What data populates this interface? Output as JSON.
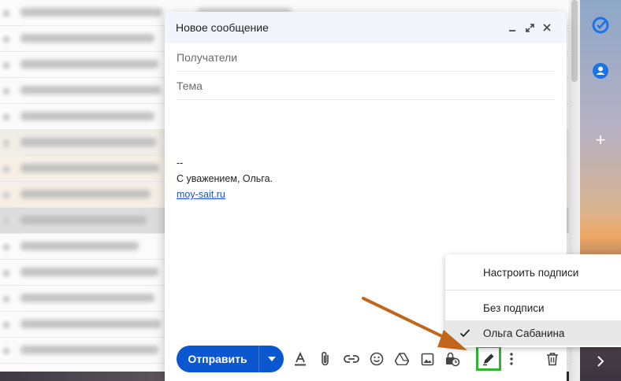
{
  "compose": {
    "title": "Новое сообщение",
    "recipients_placeholder": "Получатели",
    "subject_placeholder": "Тема",
    "signature": {
      "dashes": "--",
      "line": "С уважением, Ольга.",
      "link": "moy-sait.ru"
    },
    "send_label": "Отправить"
  },
  "signature_menu": {
    "manage": "Настроить подписи",
    "none": "Без подписи",
    "selected": "Ольга Сабанина"
  },
  "colors": {
    "primary": "#0b57d0",
    "highlight": "#2fb52f",
    "arrow": "#c0651a"
  },
  "icons": [
    "minimize-icon",
    "expand-icon",
    "close-icon",
    "dropdown-icon",
    "format-text-icon",
    "attach-icon",
    "link-icon",
    "emoji-icon",
    "drive-icon",
    "photo-icon",
    "confidential-icon",
    "signature-pen-icon",
    "more-vert-icon",
    "trash-icon",
    "check-icon",
    "tasks-icon",
    "contacts-icon",
    "plus-icon",
    "chevron-right-icon"
  ]
}
